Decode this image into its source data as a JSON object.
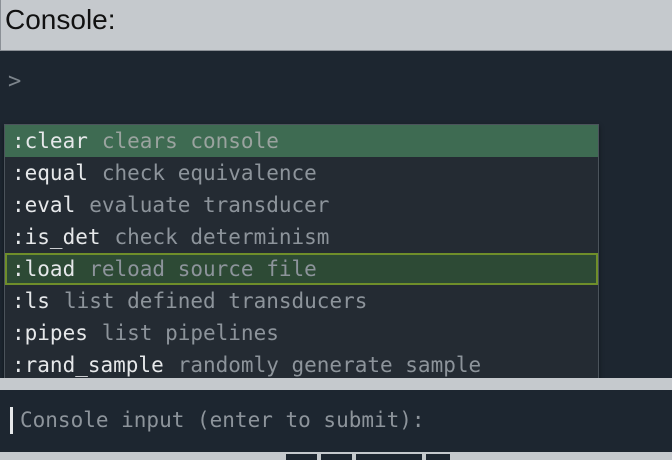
{
  "header": {
    "title": "Console:"
  },
  "output": {
    "prompt": ">"
  },
  "suggestions": [
    {
      "command": ":clear",
      "description": "clears console",
      "state": "selected"
    },
    {
      "command": ":equal",
      "description": "check equivalence",
      "state": "normal"
    },
    {
      "command": ":eval",
      "description": "evaluate transducer",
      "state": "normal"
    },
    {
      "command": ":is_det",
      "description": "check determinism",
      "state": "normal"
    },
    {
      "command": ":load",
      "description": "reload source file",
      "state": "hover"
    },
    {
      "command": ":ls",
      "description": "list defined transducers",
      "state": "normal"
    },
    {
      "command": ":pipes",
      "description": "list pipelines",
      "state": "normal"
    },
    {
      "command": ":rand_sample",
      "description": "randomly generate sample",
      "state": "normal"
    }
  ],
  "input": {
    "placeholder": "Console input (enter to submit):"
  },
  "colors": {
    "background": "#1d2630",
    "selected": "#3e6b52",
    "hover_outline": "#6f8e2a",
    "chrome": "#c5c9cd"
  }
}
